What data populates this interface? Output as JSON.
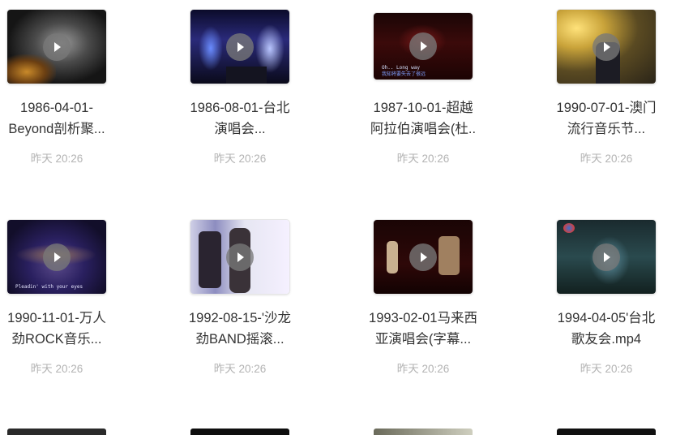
{
  "files": [
    {
      "name_line1": "1986-04-01-",
      "name_line2": "Beyond剖析聚...",
      "time": "昨天 20:26"
    },
    {
      "name_line1": "1986-08-01-台北",
      "name_line2": "演唱会...",
      "time": "昨天 20:26"
    },
    {
      "name_line1": "1987-10-01-超越",
      "name_line2": "阿拉伯演唱会(杜..",
      "time": "昨天 20:26",
      "subtitle1": "Oh.. Long way",
      "subtitle2": "我知将要失去了很远"
    },
    {
      "name_line1": "1990-07-01-澳门",
      "name_line2": "流行音乐节...",
      "time": "昨天 20:26"
    },
    {
      "name_line1": "1990-11-01-万人",
      "name_line2": "劲ROCK音乐...",
      "time": "昨天 20:26",
      "subtitle1": "Pleadin' with your eyes"
    },
    {
      "name_line1": "1992-08-15-'沙龙",
      "name_line2": "劲BAND摇滚...",
      "time": "昨天 20:26"
    },
    {
      "name_line1": "1993-02-01马来西",
      "name_line2": "亚演唱会(字幕...",
      "time": "昨天 20:26"
    },
    {
      "name_line1": "1994-04-05'台北",
      "name_line2": "歌友会.mp4",
      "time": "昨天 20:26"
    }
  ]
}
